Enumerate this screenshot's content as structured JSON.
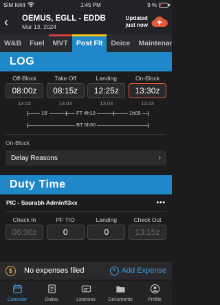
{
  "status": {
    "carrier": "SIM fehlt",
    "time": "1:45 PM",
    "battery": "9 %",
    "battery_level": 0.09
  },
  "header": {
    "title": "OEMUS, EGLL - EDDB",
    "date": "Mar 13, 2024",
    "sync_line1": "Updated",
    "sync_line2": "just now"
  },
  "tabs": [
    {
      "label": "W&B",
      "color": "#2a2b2e"
    },
    {
      "label": "Fuel",
      "color": "#2a2b2e"
    },
    {
      "label": "MVT",
      "color": "#e03a3a"
    },
    {
      "label": "Post Flt",
      "color": "#f5c518",
      "active": true
    },
    {
      "label": "Deice",
      "color": "#2a2b2e"
    },
    {
      "label": "Maintenance",
      "color": "#2a2b2e"
    }
  ],
  "log": {
    "title": "LOG",
    "blocks": [
      {
        "label": "Off-Block",
        "time": "08:00z",
        "date": "13.03"
      },
      {
        "label": "Take Off",
        "time": "08:15z",
        "date": "13.03"
      },
      {
        "label": "Landing",
        "time": "12:25z",
        "date": "13.03"
      },
      {
        "label": "On-Block",
        "time": "13:30z",
        "date": "13.03"
      }
    ],
    "taxi_out": "15'",
    "flight_time": "FT 4h10",
    "taxi_in": "1h05",
    "block_time": "BT 5h30",
    "onblock_label": "On-Block",
    "delay_label": "Delay Reasons"
  },
  "duty": {
    "title": "Duty Time",
    "pic": "PIC - Saurabh Adminfl3xx",
    "fields": [
      {
        "label": "Check In",
        "value": "06:30z"
      },
      {
        "label": "PF T/O",
        "value": "0"
      },
      {
        "label": "Landing",
        "value": "0"
      },
      {
        "label": "Check Out",
        "value": "13:15z"
      }
    ]
  },
  "expenses": {
    "message": "No expenses filed",
    "add_label": "Add Expense"
  },
  "nav": [
    {
      "label": "Calendar",
      "icon": "calendar-icon",
      "active": true
    },
    {
      "label": "Duties",
      "icon": "duties-icon"
    },
    {
      "label": "Licenses",
      "icon": "licenses-icon"
    },
    {
      "label": "Documents",
      "icon": "documents-icon"
    },
    {
      "label": "Profile",
      "icon": "profile-icon"
    }
  ]
}
